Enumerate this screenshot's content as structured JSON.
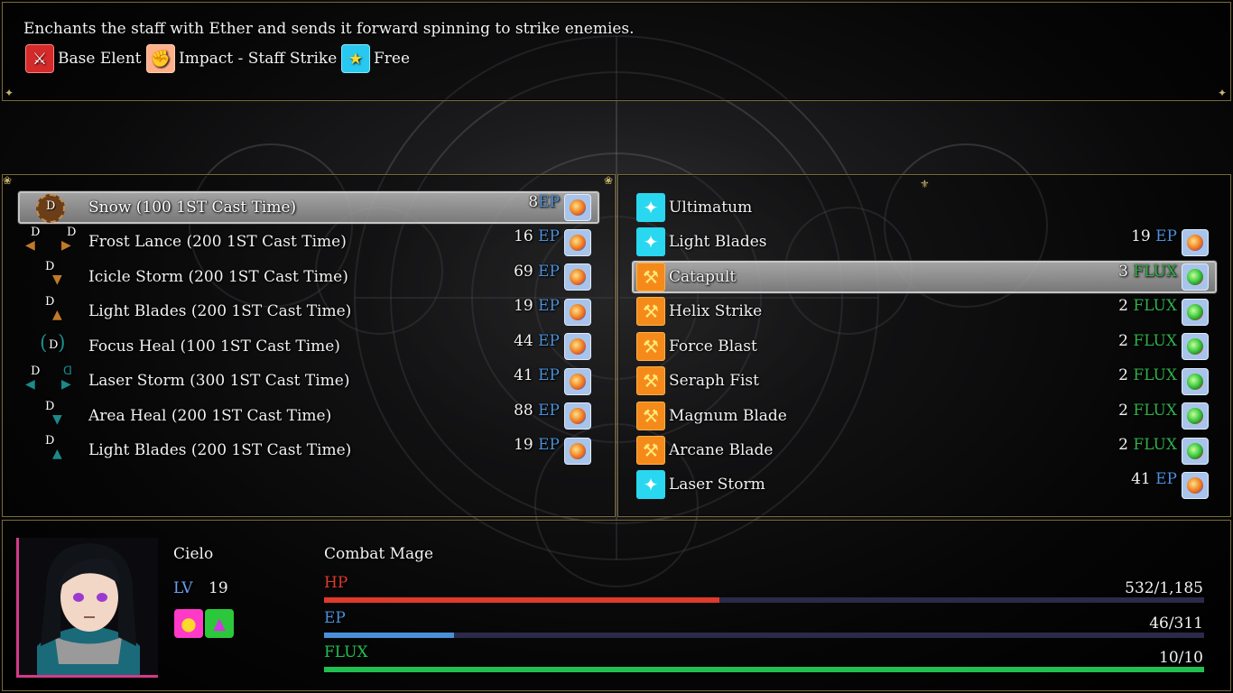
{
  "help": {
    "description": "Enchants the staff with Ether and sends it forward spinning to strike enemies.",
    "tags": [
      {
        "icon": "red-sword-icon",
        "label": "Base Elent"
      },
      {
        "icon": "impact-icon",
        "label": "Impact - Staff Strike"
      },
      {
        "icon": "star-icon",
        "label": "Free"
      }
    ]
  },
  "left_skills": [
    {
      "name": "Snow (100 1ST Cast Time)",
      "cost": "8",
      "unit": "EP",
      "selected": true,
      "icon": "snow-rune-icon"
    },
    {
      "name": "Frost Lance (200 1ST Cast Time)",
      "cost": "16",
      "unit": "EP"
    },
    {
      "name": "Icicle Storm (200 1ST Cast Time)",
      "cost": "69",
      "unit": "EP"
    },
    {
      "name": "Light Blades (200 1ST Cast Time)",
      "cost": "19",
      "unit": "EP"
    },
    {
      "name": "Focus Heal (100 1ST Cast Time)",
      "cost": "44",
      "unit": "EP"
    },
    {
      "name": "Laser Storm (300 1ST Cast Time)",
      "cost": "41",
      "unit": "EP"
    },
    {
      "name": "Area Heal (200 1ST Cast Time)",
      "cost": "88",
      "unit": "EP"
    },
    {
      "name": "Light Blades (200 1ST Cast Time)",
      "cost": "19",
      "unit": "EP"
    }
  ],
  "right_skills": [
    {
      "name": "Ultimatum",
      "cost": "",
      "unit": "",
      "icon": "sparkle-icon"
    },
    {
      "name": "Light Blades",
      "cost": "19",
      "unit": "EP",
      "icon": "sparkle-icon"
    },
    {
      "name": "Catapult",
      "cost": "3",
      "unit": "FLUX",
      "icon": "staff-icon",
      "selected": true
    },
    {
      "name": "Helix Strike",
      "cost": "2",
      "unit": "FLUX",
      "icon": "staff-icon"
    },
    {
      "name": "Force Blast",
      "cost": "2",
      "unit": "FLUX",
      "icon": "staff-icon"
    },
    {
      "name": "Seraph Fist",
      "cost": "2",
      "unit": "FLUX",
      "icon": "staff-icon"
    },
    {
      "name": "Magnum Blade",
      "cost": "2",
      "unit": "FLUX",
      "icon": "staff-icon"
    },
    {
      "name": "Arcane Blade",
      "cost": "2",
      "unit": "FLUX",
      "icon": "staff-icon"
    },
    {
      "name": "Laser Storm",
      "cost": "41",
      "unit": "EP",
      "icon": "sparkle-icon"
    }
  ],
  "status": {
    "name": "Cielo",
    "class": "Combat Mage",
    "lv_label": "LV",
    "level": "19",
    "hp_label": "HP",
    "hp_text": "532/1,185",
    "hp_fraction": 0.449,
    "ep_label": "EP",
    "ep_text": "46/311",
    "ep_fraction": 0.148,
    "flux_label": "FLUX",
    "flux_text": "10/10",
    "flux_fraction": 1.0,
    "colors": {
      "hp": "#e03a2a",
      "ep": "#4a90d9",
      "flux": "#20c050",
      "lv": "#6aa0f0"
    }
  },
  "icons": {
    "d_letter": "D"
  }
}
